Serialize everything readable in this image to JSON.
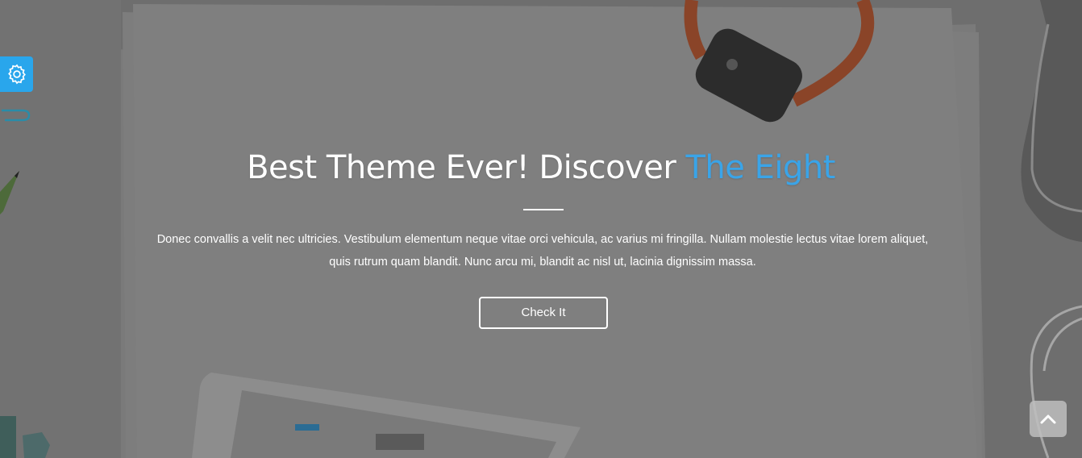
{
  "hero": {
    "headline_main": "Best Theme Ever! Discover ",
    "headline_accent": "The Eight",
    "description": "Donec convallis a velit nec ultricies. Vestibulum elementum neque vitae orci vehicula, ac varius mi fringilla. Nullam molestie lectus vitae lorem aliquet, quis rutrum quam blandit. Nunc arcu mi, blandit ac nisl ut, lacinia dignissim massa.",
    "cta_label": "Check It"
  },
  "widgets": {
    "settings_icon": "gear-icon",
    "scroll_top_icon": "chevron-up-icon"
  },
  "colors": {
    "accent": "#3aa4e8",
    "settings_bg": "#29a6ec",
    "overlay": "#6f6f6f"
  }
}
